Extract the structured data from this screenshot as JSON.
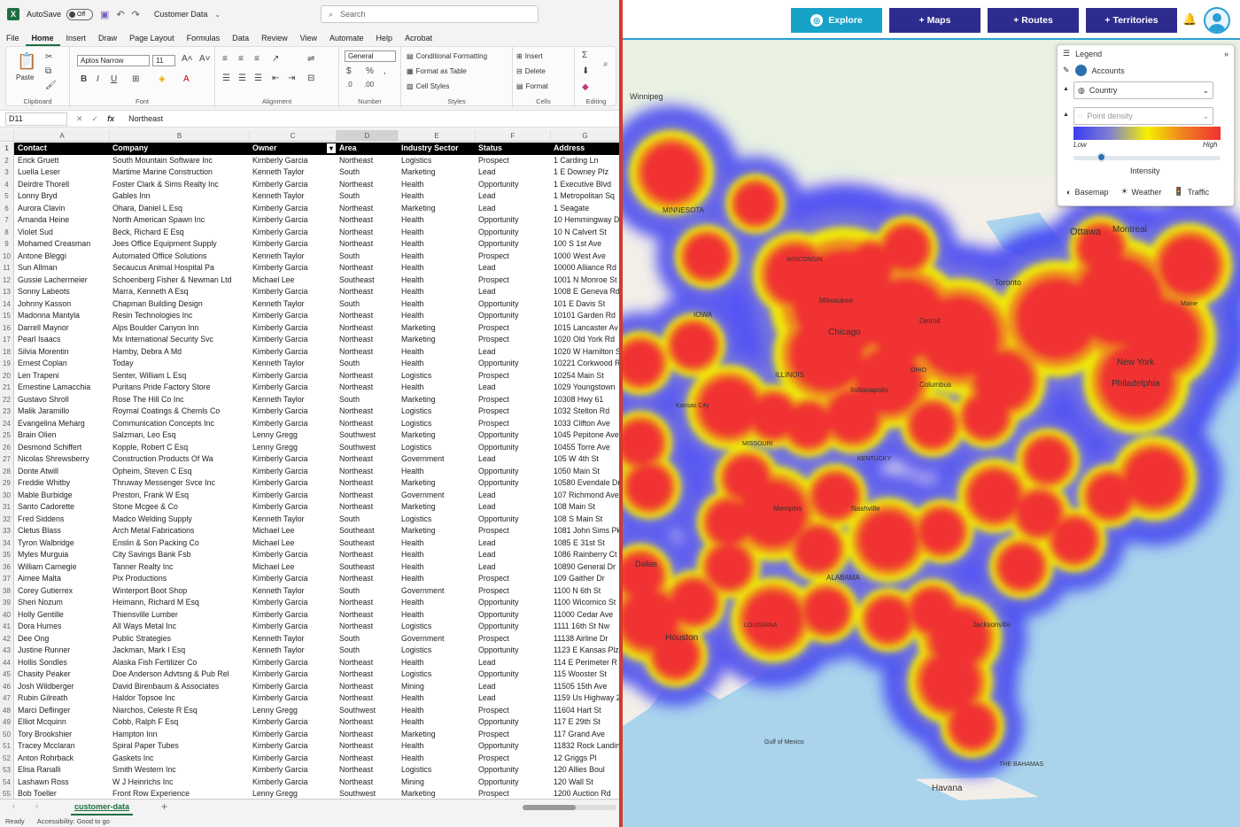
{
  "excel": {
    "titlebar": {
      "autosave_label": "AutoSave",
      "autosave_state": "Off",
      "filename": "Customer Data",
      "search_placeholder": "Search"
    },
    "menu_tabs": [
      "File",
      "Home",
      "Insert",
      "Draw",
      "Page Layout",
      "Formulas",
      "Data",
      "Review",
      "View",
      "Automate",
      "Help",
      "Acrobat"
    ],
    "ribbon": {
      "clipboard": {
        "label": "Clipboard",
        "paste": "Paste"
      },
      "font": {
        "label": "Font",
        "name": "Aptos Narrow",
        "size": "11"
      },
      "alignment": {
        "label": "Alignment"
      },
      "number": {
        "label": "Number",
        "format": "General"
      },
      "styles": {
        "label": "Styles",
        "conditional": "Conditional Formatting",
        "format_table": "Format as Table",
        "cell_styles": "Cell Styles"
      },
      "cells": {
        "label": "Cells",
        "insert": "Insert",
        "delete": "Delete",
        "format": "Format"
      },
      "editing": {
        "label": "Editing"
      }
    },
    "formula_bar": {
      "name_box": "D11",
      "fx": "fx",
      "value": "Northeast"
    },
    "columns": [
      "A",
      "B",
      "C",
      "D",
      "E",
      "F",
      "G"
    ],
    "header_row": [
      "Contact",
      "Company",
      "Owner",
      "Area",
      "Industry Sector",
      "Status",
      "Address"
    ],
    "rows": [
      [
        "Erick Gruett",
        "South Mountain Software Inc",
        "Kimberly Garcia",
        "Northeast",
        "Logistics",
        "Prospect",
        "1 Carding Ln"
      ],
      [
        "Luella Leser",
        "Martime Marine Construction",
        "Kenneth Taylor",
        "South",
        "Marketing",
        "Lead",
        "1 E Downey Plz"
      ],
      [
        "Deirdre Thorell",
        "Foster Clark & Sims Realty Inc",
        "Kimberly Garcia",
        "Northeast",
        "Health",
        "Opportunity",
        "1 Executive Blvd"
      ],
      [
        "Lonny Bryd",
        "Gables Inn",
        "Kenneth Taylor",
        "South",
        "Health",
        "Lead",
        "1 Metropolitan Sq"
      ],
      [
        "Aurora Clavin",
        "Ohara, Daniel L Esq",
        "Kimberly Garcia",
        "Northeast",
        "Marketing",
        "Lead",
        "1 Seagate"
      ],
      [
        "Amanda Heine",
        "North American Spawn Inc",
        "Kimberly Garcia",
        "Northeast",
        "Health",
        "Opportunity",
        "10 Hemmingway D"
      ],
      [
        "Violet Sud",
        "Beck, Richard E Esq",
        "Kimberly Garcia",
        "Northeast",
        "Health",
        "Opportunity",
        "10 N Calvert St"
      ],
      [
        "Mohamed Creasman",
        "Joes Office Equipment Supply",
        "Kimberly Garcia",
        "Northeast",
        "Health",
        "Opportunity",
        "100 S 1st Ave"
      ],
      [
        "Antone Bleggi",
        "Automated Office Solutions",
        "Kenneth Taylor",
        "South",
        "Health",
        "Prospect",
        "1000 West Ave"
      ],
      [
        "Sun Allman",
        "Secaucus Animal Hospital Pa",
        "Kimberly Garcia",
        "Northeast",
        "Health",
        "Lead",
        "10000 Alliance Rd"
      ],
      [
        "Gussie Lachermeier",
        "Schoenberg Fisher & Newman Ltd",
        "Michael Lee",
        "Southeast",
        "Health",
        "Prospect",
        "1001 N Monroe St"
      ],
      [
        "Sonny Labeots",
        "Marra, Kenneth A Esq",
        "Kimberly Garcia",
        "Northeast",
        "Health",
        "Lead",
        "1008 E Geneva Rd"
      ],
      [
        "Johnny Kasson",
        "Chapman Building Design",
        "Kenneth Taylor",
        "South",
        "Health",
        "Opportunity",
        "101 E Davis St"
      ],
      [
        "Madonna Mantyla",
        "Resin Technologies Inc",
        "Kimberly Garcia",
        "Northeast",
        "Health",
        "Opportunity",
        "10101 Garden Rd"
      ],
      [
        "Darrell Maynor",
        "Alps Boulder Canyon Inn",
        "Kimberly Garcia",
        "Northeast",
        "Marketing",
        "Prospect",
        "1015 Lancaster Av"
      ],
      [
        "Pearl Isaacs",
        "Mx International Security Svc",
        "Kimberly Garcia",
        "Northeast",
        "Marketing",
        "Prospect",
        "1020 Old York Rd"
      ],
      [
        "Silvia Morentin",
        "Hamby, Debra A Md",
        "Kimberly Garcia",
        "Northeast",
        "Health",
        "Lead",
        "1020 W Hamilton S"
      ],
      [
        "Ernest Coplan",
        "Today",
        "Kenneth Taylor",
        "South",
        "Health",
        "Opportunity",
        "10221 Corkwood R"
      ],
      [
        "Len Trapeni",
        "Senter, William L Esq",
        "Kimberly Garcia",
        "Northeast",
        "Logistics",
        "Prospect",
        "10254 Main St"
      ],
      [
        "Ernestine Lamacchia",
        "Puritans Pride Factory Store",
        "Kimberly Garcia",
        "Northeast",
        "Health",
        "Lead",
        "1029 Youngstown"
      ],
      [
        "Gustavo Shroll",
        "Rose The Hill Co Inc",
        "Kenneth Taylor",
        "South",
        "Marketing",
        "Prospect",
        "10308 Hwy 61"
      ],
      [
        "Malik Jaramillo",
        "Roymal Coatings & Chemls Co",
        "Kimberly Garcia",
        "Northeast",
        "Logistics",
        "Prospect",
        "1032 Stelton Rd"
      ],
      [
        "Evangelina Meharg",
        "Communication Concepts Inc",
        "Kimberly Garcia",
        "Northeast",
        "Logistics",
        "Prospect",
        "1033 Clifton Ave"
      ],
      [
        "Brain Olien",
        "Salzman, Leo Esq",
        "Lenny Gregg",
        "Southwest",
        "Marketing",
        "Opportunity",
        "1045 Pepitone Ave"
      ],
      [
        "Desmond Schiffert",
        "Kopple, Robert C Esq",
        "Lenny Gregg",
        "Southwest",
        "Logistics",
        "Opportunity",
        "10455 Torre Ave"
      ],
      [
        "Nicolas Shrewsberry",
        "Construction Products Of Wa",
        "Kimberly Garcia",
        "Northeast",
        "Government",
        "Lead",
        "105 W 4th St"
      ],
      [
        "Donte Atwill",
        "Opheim, Steven C Esq",
        "Kimberly Garcia",
        "Northeast",
        "Health",
        "Opportunity",
        "1050 Main St"
      ],
      [
        "Freddie Whitby",
        "Thruway Messenger Svce Inc",
        "Kimberly Garcia",
        "Northeast",
        "Marketing",
        "Opportunity",
        "10580 Evendale Dr"
      ],
      [
        "Mable Burbidge",
        "Preston, Frank W Esq",
        "Kimberly Garcia",
        "Northeast",
        "Government",
        "Lead",
        "107 Richmond Ave"
      ],
      [
        "Santo Cadorette",
        "Stone Mcgee & Co",
        "Kimberly Garcia",
        "Northeast",
        "Marketing",
        "Lead",
        "108 Main St"
      ],
      [
        "Fred Siddens",
        "Madco Welding Supply",
        "Kenneth Taylor",
        "South",
        "Logistics",
        "Opportunity",
        "108 S Main St"
      ],
      [
        "Cletus Blass",
        "Arch Metal Fabrications",
        "Michael Lee",
        "Southeast",
        "Marketing",
        "Prospect",
        "1081 John Sims Pk"
      ],
      [
        "Tyron Walbridge",
        "Enslin & Son Packing Co",
        "Michael Lee",
        "Southeast",
        "Health",
        "Lead",
        "1085 E 31st St"
      ],
      [
        "Myles Murguia",
        "City Savings Bank Fsb",
        "Kimberly Garcia",
        "Northeast",
        "Health",
        "Lead",
        "1086 Rainberry Ct"
      ],
      [
        "William Carnegie",
        "Tanner Realty Inc",
        "Michael Lee",
        "Southeast",
        "Health",
        "Lead",
        "10890 General Dr"
      ],
      [
        "Aimee Malta",
        "Pix Productions",
        "Kimberly Garcia",
        "Northeast",
        "Health",
        "Prospect",
        "109 Gaither Dr"
      ],
      [
        "Corey Gutierrex",
        "Winterport Boot Shop",
        "Kenneth Taylor",
        "South",
        "Government",
        "Prospect",
        "1100 N 6th St"
      ],
      [
        "Sheri Nozum",
        "Heimann, Richard M Esq",
        "Kimberly Garcia",
        "Northeast",
        "Health",
        "Opportunity",
        "1100 Wicomico St"
      ],
      [
        "Holly Gentille",
        "Thiensville Lumber",
        "Kimberly Garcia",
        "Northeast",
        "Health",
        "Opportunity",
        "11000 Cedar Ave"
      ],
      [
        "Dora Humes",
        "All Ways Metal Inc",
        "Kimberly Garcia",
        "Northeast",
        "Logistics",
        "Opportunity",
        "1111 16th St Nw"
      ],
      [
        "Dee Ong",
        "Public Strategies",
        "Kenneth Taylor",
        "South",
        "Government",
        "Prospect",
        "11138 Airline Dr"
      ],
      [
        "Justine Runner",
        "Jackman, Mark I Esq",
        "Kenneth Taylor",
        "South",
        "Logistics",
        "Opportunity",
        "1123 E Kansas Plz"
      ],
      [
        "Hollis Sondles",
        "Alaska Fish Fertilizer Co",
        "Kimberly Garcia",
        "Northeast",
        "Health",
        "Lead",
        "114 E Perimeter R"
      ],
      [
        "Chasity Peaker",
        "Doe Anderson Advtsng & Pub Rel",
        "Kimberly Garcia",
        "Northeast",
        "Logistics",
        "Opportunity",
        "115 Wooster St"
      ],
      [
        "Josh Wildberger",
        "David Birenbaum & Associates",
        "Kimberly Garcia",
        "Northeast",
        "Mining",
        "Lead",
        "11505 15th Ave"
      ],
      [
        "Rubin Gilreath",
        "Haldor Topsoe Inc",
        "Kimberly Garcia",
        "Northeast",
        "Health",
        "Lead",
        "1159 Us Highway 2"
      ],
      [
        "Marci Deflinger",
        "Niarchos, Celeste R Esq",
        "Lenny Gregg",
        "Southwest",
        "Health",
        "Prospect",
        "11604 Hart St"
      ],
      [
        "Elliot Mcquinn",
        "Cobb, Ralph F Esq",
        "Kimberly Garcia",
        "Northeast",
        "Health",
        "Opportunity",
        "117 E 29th St"
      ],
      [
        "Tory Brookshier",
        "Hampton Inn",
        "Kimberly Garcia",
        "Northeast",
        "Marketing",
        "Prospect",
        "117 Grand Ave"
      ],
      [
        "Tracey Mcclaran",
        "Spiral Paper Tubes",
        "Kimberly Garcia",
        "Northeast",
        "Health",
        "Opportunity",
        "11832 Rock Landin"
      ],
      [
        "Anton Rohrback",
        "Gaskets Inc",
        "Kimberly Garcia",
        "Northeast",
        "Health",
        "Prospect",
        "12 Griggs Pl"
      ],
      [
        "Elisa Ranalli",
        "Smith Western Inc",
        "Kimberly Garcia",
        "Northeast",
        "Logistics",
        "Opportunity",
        "120 Allies Boul"
      ],
      [
        "Lashawn Ross",
        "W J Heinrichs Inc",
        "Kimberly Garcia",
        "Northeast",
        "Mining",
        "Opportunity",
        "120 Wall St"
      ],
      [
        "Bob Toeller",
        "Front Row Experience",
        "Lenny Gregg",
        "Southwest",
        "Marketing",
        "Prospect",
        "1200 Auction Rd"
      ]
    ],
    "sheet_tab": "customer-data",
    "status": {
      "ready": "Ready",
      "accessibility": "Accessibility: Good to go"
    }
  },
  "map": {
    "buttons": {
      "explore": "Explore",
      "maps": "+ Maps",
      "routes": "+ Routes",
      "territories": "+ Territories"
    },
    "legend": {
      "title": "Legend",
      "accounts": "Accounts",
      "group_by": "Country",
      "layer": "Point density",
      "low": "Low",
      "high": "High",
      "intensity": "Intensity",
      "basemap": "Basemap",
      "weather": "Weather",
      "traffic": "Traffic"
    },
    "labels": [
      "Winnipeg",
      "MINNESOTA",
      "Ottawa",
      "Montreal",
      "WISCONSIN",
      "Toronto",
      "Maine",
      "IOWA",
      "Chicago",
      "Milwaukee",
      "Detroit",
      "New York",
      "Philadelphia",
      "OHIO",
      "Columbus",
      "Indianapolis",
      "ILLINOIS",
      "Kansas City",
      "MISSOURI",
      "KENTUCKY",
      "Nashville",
      "Memphis",
      "Dallas",
      "ALABAMA",
      "Houston",
      "LOUISIANA",
      "Jacksonville",
      "Gulf of Mexico",
      "THE BAHAMAS",
      "Havana"
    ],
    "colors": {
      "hot": "#f03030",
      "warm": "#f5f000",
      "cool": "#3b3bf5",
      "water": "#a9d4ec",
      "land": "#f2efe9"
    }
  }
}
